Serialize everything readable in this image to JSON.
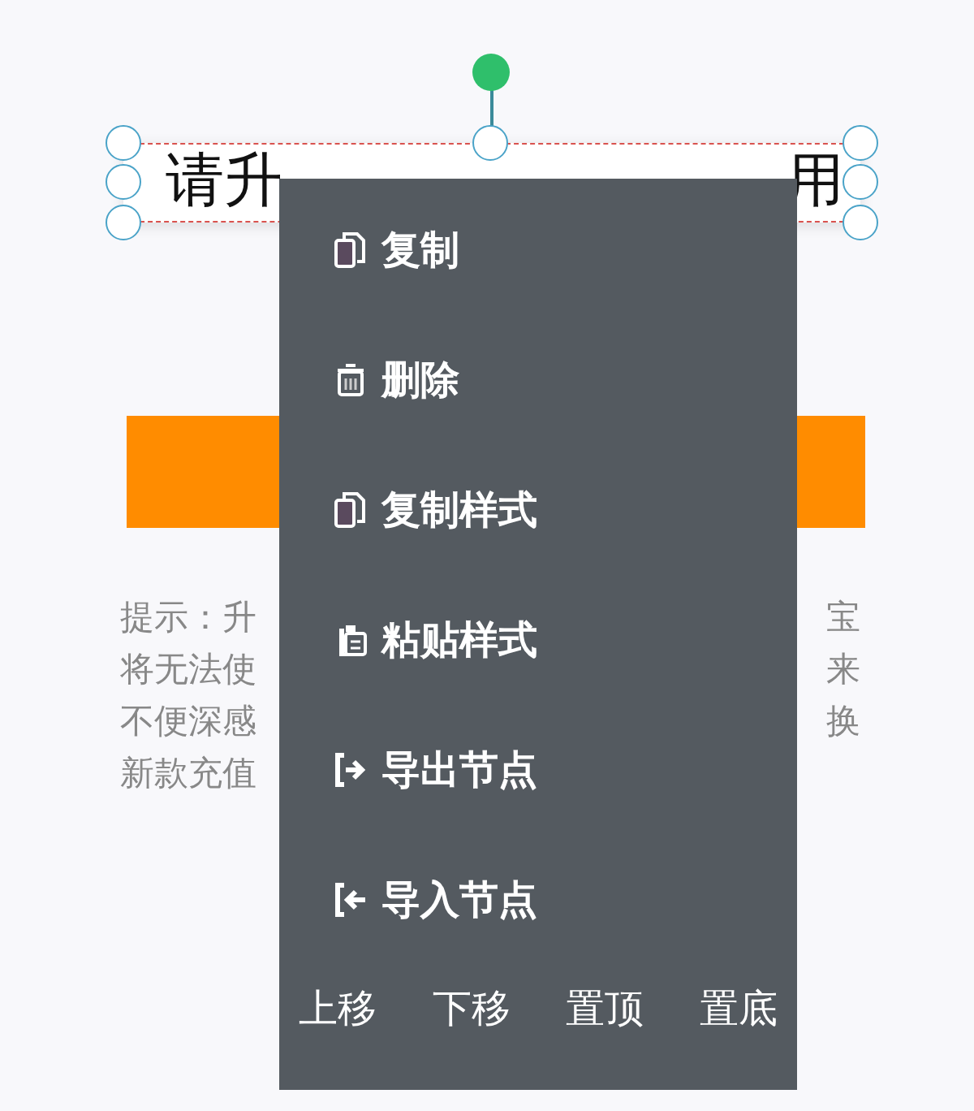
{
  "canvas": {
    "title_fragments": [
      "请升",
      "用"
    ],
    "hint_left": [
      "提示：升",
      "将无法使",
      "不便深感",
      "新款充值"
    ],
    "hint_right": [
      "宝",
      "来",
      "换"
    ]
  },
  "context_menu": {
    "items": [
      {
        "kind": "copy",
        "label": "复制"
      },
      {
        "kind": "delete",
        "label": "删除"
      },
      {
        "kind": "copy",
        "label": "复制样式"
      },
      {
        "kind": "paste",
        "label": "粘贴样式"
      },
      {
        "kind": "export",
        "label": "导出节点"
      },
      {
        "kind": "import",
        "label": "导入节点"
      }
    ],
    "order_buttons": [
      "上移",
      "下移",
      "置顶",
      "置底"
    ]
  }
}
